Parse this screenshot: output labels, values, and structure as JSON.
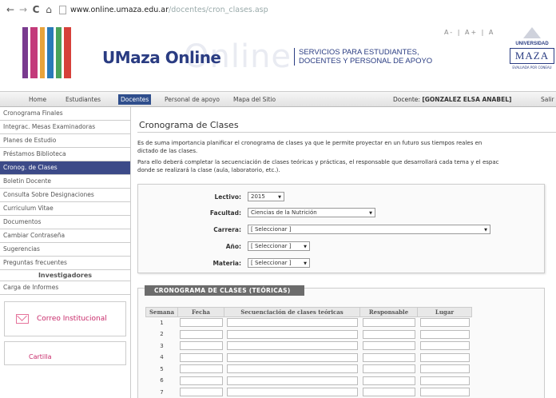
{
  "browser": {
    "back_icon": "back-arrow-icon",
    "forward_icon": "forward-arrow-icon",
    "reload_icon": "reload-icon",
    "home_icon": "home-icon",
    "url_host": "www.online.umaza.edu.ar",
    "url_path": "/docentes/cron_clases.asp"
  },
  "banner": {
    "brand_name": "UMaza Online",
    "brand_ghost": "Online",
    "services_line1": "SERVICIOS PARA ESTUDIANTES,",
    "services_line2": "DOCENTES Y PERSONAL DE APOYO",
    "font_tools": "A- | A+ | A",
    "logo_colors": [
      "#7a3b8f",
      "#c33a7a",
      "#e8a33b",
      "#2a7ab8",
      "#4aa35a",
      "#d6403a"
    ],
    "uni_top": "UNIVERSIDAD",
    "uni_name": "MAZA",
    "uni_sub": "EVALUADA POR CONEAU"
  },
  "topnav": {
    "items": [
      "Home",
      "Estudiantes",
      "Docentes",
      "Personal de apoyo",
      "Mapa del Sitio"
    ],
    "active": "Docentes",
    "docente_label": "Docente:",
    "docente_name": "[GONZALEZ ELSA ANABEL]",
    "salir": "Salir"
  },
  "sidebar": {
    "items": [
      "Cronograma Finales",
      "Integrac. Mesas Examinadoras",
      "Planes de Estudio",
      "Préstamos Biblioteca",
      "Cronog. de Clases",
      "Boletin Docente",
      "Consulta Sobre Designaciones",
      "Curriculum Vitae",
      "Documentos",
      "Cambiar Contraseña",
      "Sugerencias",
      "Preguntas frecuentes"
    ],
    "active_index": 4,
    "section": "Investigadores",
    "after_section": "Carga de Informes",
    "correo": "Correo Institucional",
    "cartilla": "Cartilla"
  },
  "main": {
    "title": "Cronograma de Clases",
    "para1_line1": "Es de suma importancia planificar el cronograma de clases ya que le permite proyectar en un futuro sus tiempos reales en",
    "para1_line2": "dictado de las clases.",
    "para2_line1": "Para ello deberá completar la secuenciación de clases teóricas y prácticas, el responsable que desarrollará cada tema y el espac",
    "para2_line2": "donde se realizará la clase (aula, laboratorio, etc.)."
  },
  "form": {
    "lectivo_label": "Lectivo:",
    "lectivo_value": "2015",
    "facultad_label": "Facultad:",
    "facultad_value": "Ciencias de la Nutrición",
    "carrera_label": "Carrera:",
    "carrera_value": "[ Seleccionar ]",
    "anio_label": "Año:",
    "anio_value": "[ Seleccionar ]",
    "materia_label": "Materia:",
    "materia_value": "[ Seleccionar ]"
  },
  "schedule": {
    "tab_title": "CRONOGRAMA DE CLASES (TEÓRICAS)",
    "headers": [
      "Semana",
      "Fecha",
      "Secuenciación de clases teóricas",
      "Responsable",
      "Lugar"
    ],
    "weeks": [
      "1",
      "2",
      "3",
      "4",
      "5",
      "6",
      "7"
    ]
  }
}
